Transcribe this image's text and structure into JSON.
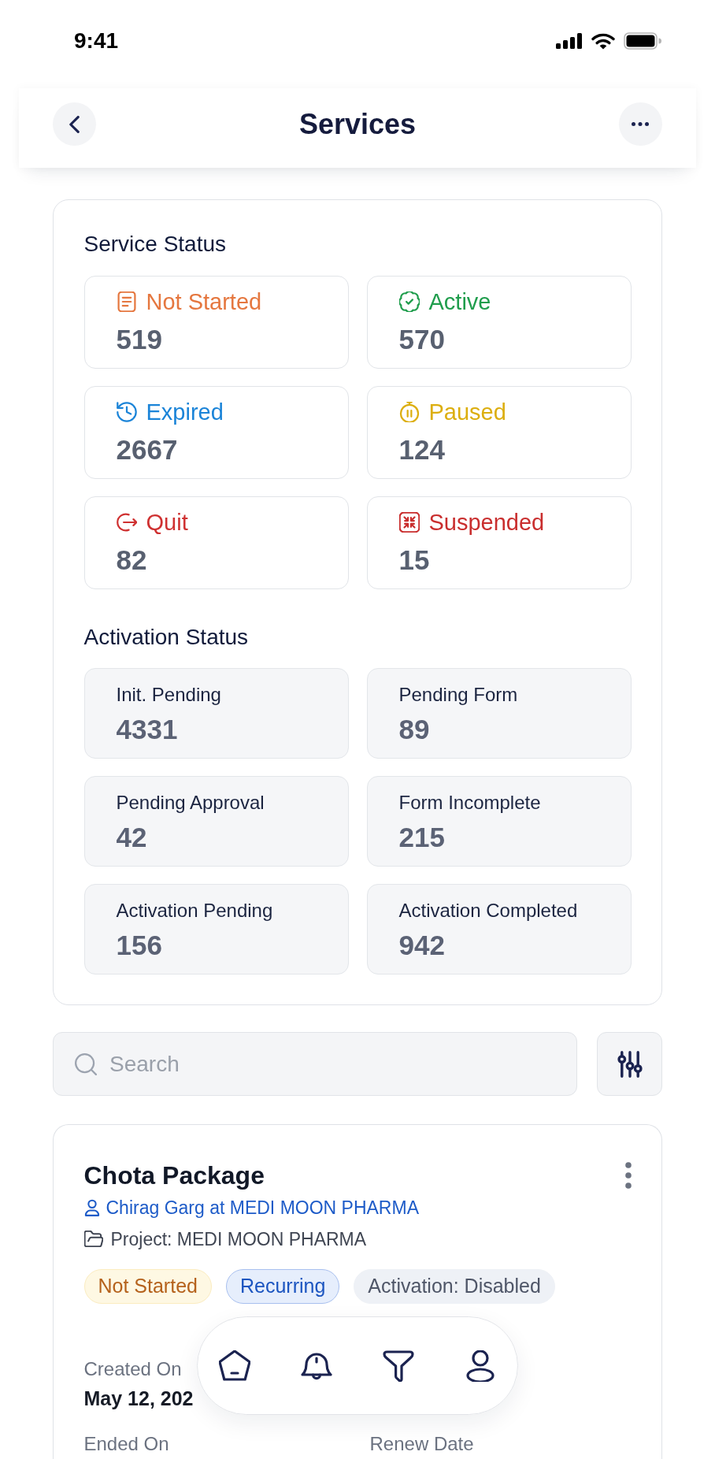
{
  "status_bar": {
    "time": "9:41"
  },
  "header": {
    "title": "Services"
  },
  "service_status": {
    "title": "Service Status",
    "items": [
      {
        "kind": "document",
        "label": "Not Started",
        "count": "519",
        "color": "#e5773f"
      },
      {
        "kind": "badge-check",
        "label": "Active",
        "count": "570",
        "color": "#1f9d4c"
      },
      {
        "kind": "history",
        "label": "Expired",
        "count": "2667",
        "color": "#1b84d8"
      },
      {
        "kind": "stopwatch",
        "label": "Paused",
        "count": "124",
        "color": "#dcae0e"
      },
      {
        "kind": "exit",
        "label": "Quit",
        "count": "82",
        "color": "#cf3131"
      },
      {
        "kind": "collapse",
        "label": "Suspended",
        "count": "15",
        "color": "#c92e2e"
      }
    ]
  },
  "activation_status": {
    "title": "Activation Status",
    "items": [
      {
        "label": "Init. Pending",
        "count": "4331"
      },
      {
        "label": "Pending Form",
        "count": "89"
      },
      {
        "label": "Pending Approval",
        "count": "42"
      },
      {
        "label": "Form Incomplete",
        "count": "215"
      },
      {
        "label": "Activation Pending",
        "count": "156"
      },
      {
        "label": "Activation Completed",
        "count": "942"
      }
    ]
  },
  "search": {
    "placeholder": "Search"
  },
  "service_card": {
    "title": "Chota Package",
    "contact": "Chirag Garg at MEDI MOON PHARMA",
    "project": "Project: MEDI MOON PHARMA",
    "tags": [
      {
        "kind": "status",
        "label": "Not Started"
      },
      {
        "kind": "billing",
        "label": "Recurring"
      },
      {
        "kind": "activation",
        "label": "Activation: Disabled"
      }
    ],
    "details": [
      {
        "cells": [
          {
            "label": "Created On",
            "value": "May 12, 202"
          }
        ]
      },
      {
        "cells": [
          {
            "label": "Ended On"
          },
          {
            "label": "Renew Date"
          }
        ]
      }
    ]
  },
  "bottom_nav": {
    "items": [
      {
        "kind": "home"
      },
      {
        "kind": "bell"
      },
      {
        "kind": "filter"
      },
      {
        "kind": "person"
      }
    ]
  }
}
